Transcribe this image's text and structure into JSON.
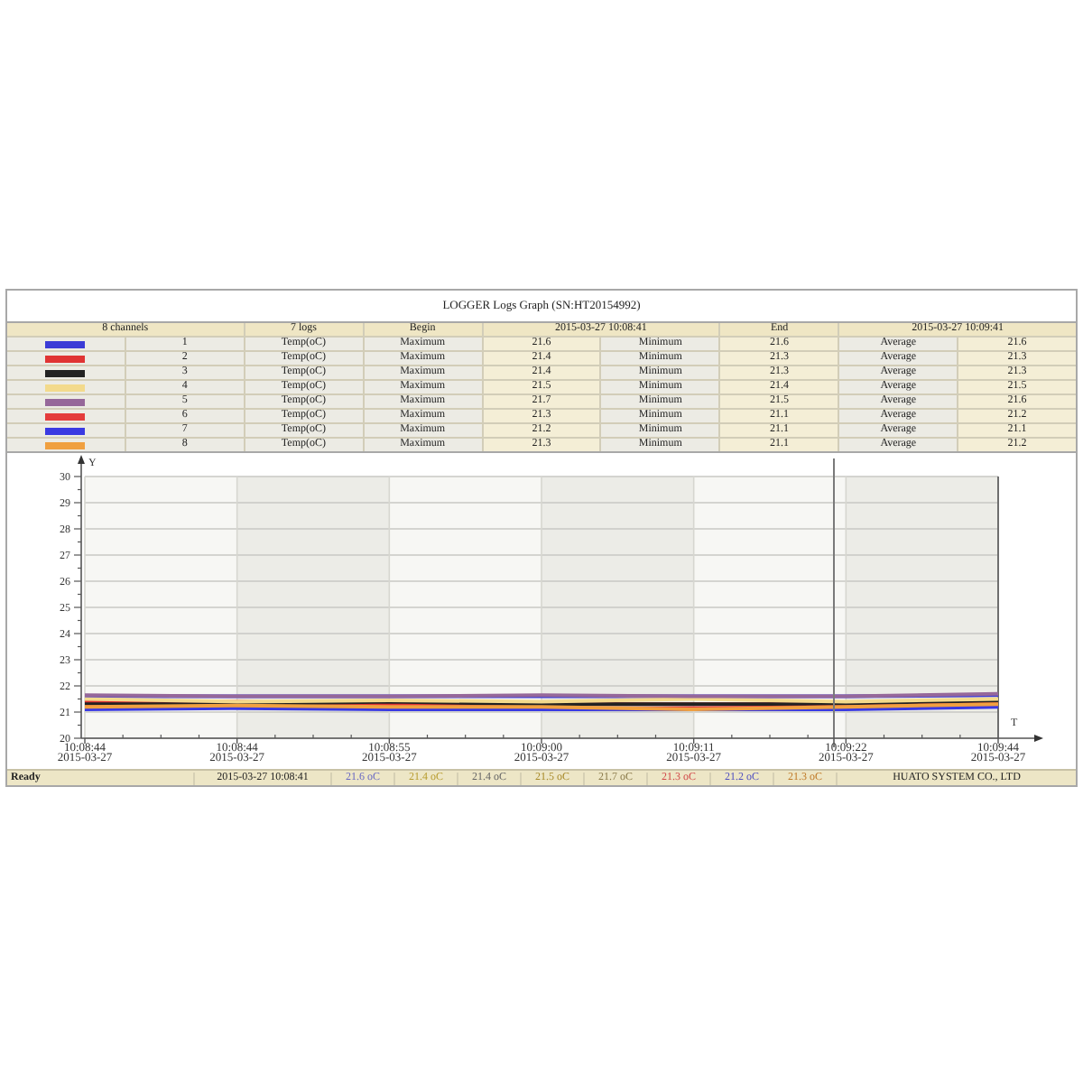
{
  "window": {
    "title": "LOGGER Logs Graph (SN:HT20154992)"
  },
  "summary": {
    "channels_label": "8 channels",
    "logs_label": "7 logs",
    "begin_label": "Begin",
    "begin_time": "2015-03-27 10:08:41",
    "end_label": "End",
    "end_time": "2015-03-27 10:09:41"
  },
  "channels": [
    {
      "color": "#3b3bd6",
      "index": "1",
      "unit": "Temp(oC)",
      "max_label": "Maximum",
      "max": "21.6",
      "min_label": "Minimum",
      "min": "21.6",
      "avg_label": "Average",
      "avg": "21.6"
    },
    {
      "color": "#e03434",
      "index": "2",
      "unit": "Temp(oC)",
      "max_label": "Maximum",
      "max": "21.4",
      "min_label": "Minimum",
      "min": "21.3",
      "avg_label": "Average",
      "avg": "21.3"
    },
    {
      "color": "#222222",
      "index": "3",
      "unit": "Temp(oC)",
      "max_label": "Maximum",
      "max": "21.4",
      "min_label": "Minimum",
      "min": "21.3",
      "avg_label": "Average",
      "avg": "21.3"
    },
    {
      "color": "#f3da8c",
      "index": "4",
      "unit": "Temp(oC)",
      "max_label": "Maximum",
      "max": "21.5",
      "min_label": "Minimum",
      "min": "21.4",
      "avg_label": "Average",
      "avg": "21.5"
    },
    {
      "color": "#96689a",
      "index": "5",
      "unit": "Temp(oC)",
      "max_label": "Maximum",
      "max": "21.7",
      "min_label": "Minimum",
      "min": "21.5",
      "avg_label": "Average",
      "avg": "21.6"
    },
    {
      "color": "#e43c3c",
      "index": "6",
      "unit": "Temp(oC)",
      "max_label": "Maximum",
      "max": "21.3",
      "min_label": "Minimum",
      "min": "21.1",
      "avg_label": "Average",
      "avg": "21.2"
    },
    {
      "color": "#3a3ae2",
      "index": "7",
      "unit": "Temp(oC)",
      "max_label": "Maximum",
      "max": "21.2",
      "min_label": "Minimum",
      "min": "21.1",
      "avg_label": "Average",
      "avg": "21.1"
    },
    {
      "color": "#f0a040",
      "index": "8",
      "unit": "Temp(oC)",
      "max_label": "Maximum",
      "max": "21.3",
      "min_label": "Minimum",
      "min": "21.1",
      "avg_label": "Average",
      "avg": "21.2"
    }
  ],
  "chart": {
    "y_axis_label": "Y",
    "x_axis_label": "T",
    "y_ticks": [
      "30",
      "29",
      "28",
      "27",
      "26",
      "25",
      "24",
      "23",
      "22",
      "21",
      "20"
    ],
    "x_ticks": [
      {
        "time": "10:08:44",
        "date": "2015-03-27"
      },
      {
        "time": "10:08:44",
        "date": "2015-03-27"
      },
      {
        "time": "10:08:55",
        "date": "2015-03-27"
      },
      {
        "time": "10:09:00",
        "date": "2015-03-27"
      },
      {
        "time": "10:09:11",
        "date": "2015-03-27"
      },
      {
        "time": "10:09:22",
        "date": "2015-03-27"
      },
      {
        "time": "10:09:44",
        "date": "2015-03-27"
      }
    ]
  },
  "status_bar": {
    "state": "Ready",
    "time": "2015-03-27 10:08:41",
    "readings": [
      {
        "text": "21.6 oC",
        "color": "#6a6ac4"
      },
      {
        "text": "21.4 oC",
        "color": "#b89c30"
      },
      {
        "text": "21.4 oC",
        "color": "#666666"
      },
      {
        "text": "21.5 oC",
        "color": "#a88a2a"
      },
      {
        "text": "21.7 oC",
        "color": "#8a7a4a"
      },
      {
        "text": "21.3 oC",
        "color": "#d24a4a"
      },
      {
        "text": "21.2 oC",
        "color": "#5050c0"
      },
      {
        "text": "21.3 oC",
        "color": "#c07a28"
      }
    ],
    "company": "HUATO SYSTEM CO., LTD"
  }
}
